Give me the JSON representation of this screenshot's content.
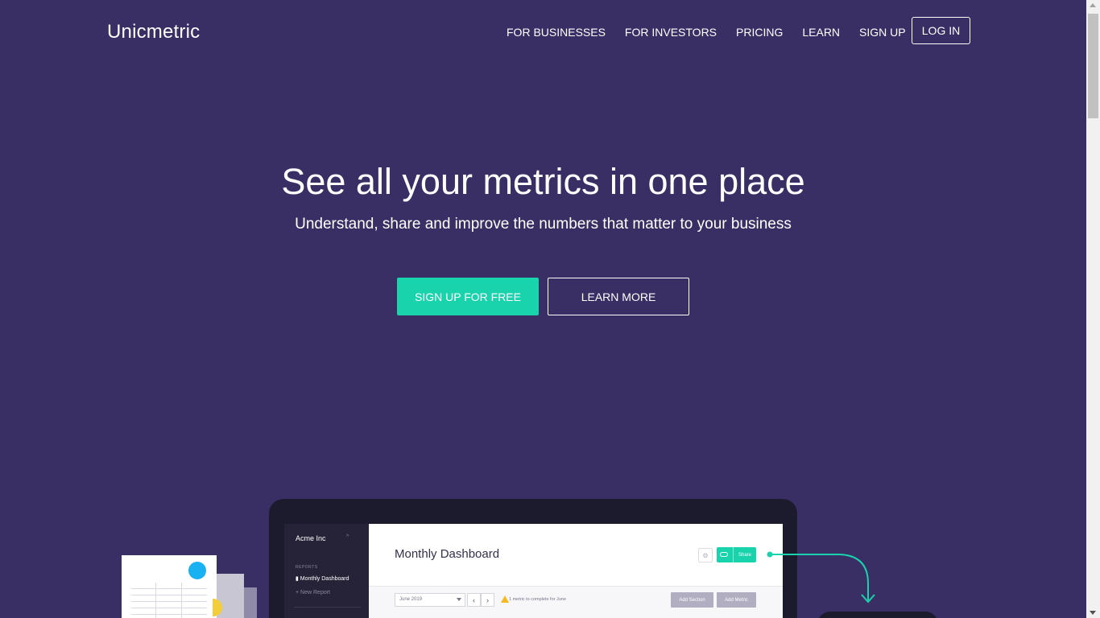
{
  "header": {
    "logo": "Unicmetric",
    "nav": [
      "FOR BUSINESSES",
      "FOR INVESTORS",
      "PRICING",
      "LEARN",
      "SIGN UP"
    ],
    "login": "LOG IN"
  },
  "hero": {
    "title": "See all your metrics in one place",
    "subtitle": "Understand, share and improve the numbers that matter to your business",
    "primary_cta": "SIGN UP FOR FREE",
    "secondary_cta": "LEARN MORE"
  },
  "illustration": {
    "sidebar": {
      "company": "Acme Inc",
      "section": "REPORTS",
      "active_item": "Monthly Dashboard",
      "new_item": "New Report"
    },
    "main": {
      "title": "Monthly Dashboard",
      "share": "Share",
      "month": "June 2019",
      "warning": "1 metric to complete for June",
      "add_section": "Add Section",
      "add_metric": "Add Metric"
    }
  },
  "colors": {
    "background": "#392f64",
    "accent": "#19d3ad",
    "text": "#ffffff"
  }
}
